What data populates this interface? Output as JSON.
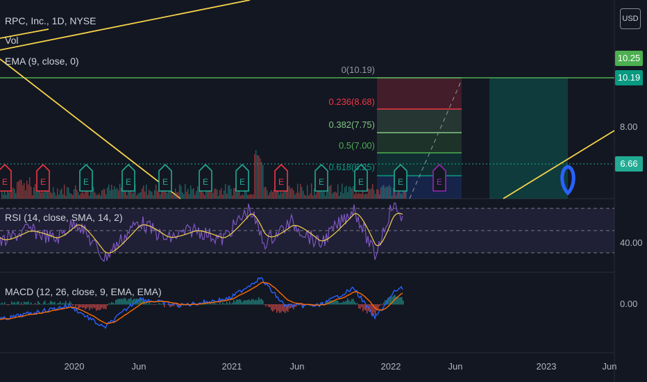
{
  "header": {
    "title": "RPC, Inc., 1D, NYSE",
    "vol_label": "Vol",
    "ema_label": "EMA (9, close, 0)",
    "currency": "USD"
  },
  "price_axis": {
    "ticks": [
      "8.00"
    ],
    "badges": [
      {
        "text": "10.25",
        "color": "#4caf50"
      },
      {
        "text": "10.19",
        "color": "#089981"
      },
      {
        "text": "6.66",
        "color": "#22ab94"
      }
    ]
  },
  "fib_levels": [
    {
      "text": "0(10.19)",
      "color": "#9598a1"
    },
    {
      "text": "0.236(8.68)",
      "color": "#f23645"
    },
    {
      "text": "0.382(7.75)",
      "color": "#81c784"
    },
    {
      "text": "0.5(7.00)",
      "color": "#4caf50"
    },
    {
      "text": "0.618(6.25)",
      "color": "#089981"
    }
  ],
  "rsi": {
    "label": "RSI (14, close, SMA, 14, 2)",
    "tick": "40.00"
  },
  "macd": {
    "label": "MACD (12, 26, close, 9, EMA, EMA)",
    "tick": "0.00"
  },
  "x_axis": {
    "ticks": [
      "2020",
      "Jun",
      "2021",
      "Jun",
      "2022",
      "Jun",
      "2023",
      "Jun"
    ]
  },
  "earnings_markers": [
    {
      "text": "E",
      "color": "#f23645"
    },
    {
      "text": "E",
      "color": "#f23645"
    },
    {
      "text": "E",
      "color": "#22ab94"
    },
    {
      "text": "E",
      "color": "#22ab94"
    },
    {
      "text": "E",
      "color": "#22ab94"
    },
    {
      "text": "E",
      "color": "#22ab94"
    },
    {
      "text": "E",
      "color": "#22ab94"
    },
    {
      "text": "E",
      "color": "#f23645"
    },
    {
      "text": "E",
      "color": "#22ab94"
    },
    {
      "text": "E",
      "color": "#22ab94"
    },
    {
      "text": "E",
      "color": "#22ab94"
    },
    {
      "text": "E",
      "color": "#9c27b0"
    }
  ],
  "chart_data": {
    "type": "line",
    "symbol": "RPC, Inc.",
    "interval": "1D",
    "exchange": "NYSE",
    "current_price": 6.66,
    "fib_retracement": [
      {
        "ratio": 0,
        "price": 10.19
      },
      {
        "ratio": 0.236,
        "price": 8.68
      },
      {
        "ratio": 0.382,
        "price": 7.75
      },
      {
        "ratio": 0.5,
        "price": 7.0
      },
      {
        "ratio": 0.618,
        "price": 6.25
      }
    ],
    "price_levels": [
      10.25,
      10.19,
      8.0,
      6.66
    ],
    "indicators": [
      "Vol",
      "EMA (9, close, 0)",
      "RSI (14, close, SMA, 14, 2)",
      "MACD (12, 26, close, 9, EMA, EMA)"
    ]
  }
}
